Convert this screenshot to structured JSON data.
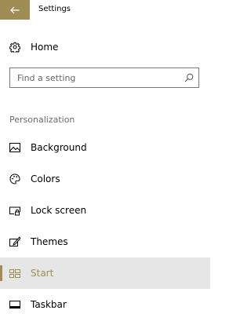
{
  "window": {
    "title": "Settings"
  },
  "accent_color": "#a08c55",
  "selected_background": "#e6e6e6",
  "home": {
    "label": "Home",
    "icon": "gear-icon"
  },
  "search": {
    "placeholder": "Find a setting",
    "value": "",
    "icon": "search-icon"
  },
  "section": {
    "title": "Personalization"
  },
  "nav": {
    "items": [
      {
        "label": "Background",
        "icon": "picture-icon",
        "selected": false
      },
      {
        "label": "Colors",
        "icon": "palette-icon",
        "selected": false
      },
      {
        "label": "Lock screen",
        "icon": "lock-screen-icon",
        "selected": false
      },
      {
        "label": "Themes",
        "icon": "themes-icon",
        "selected": false
      },
      {
        "label": "Start",
        "icon": "start-icon",
        "selected": true
      },
      {
        "label": "Taskbar",
        "icon": "taskbar-icon",
        "selected": false
      }
    ]
  }
}
